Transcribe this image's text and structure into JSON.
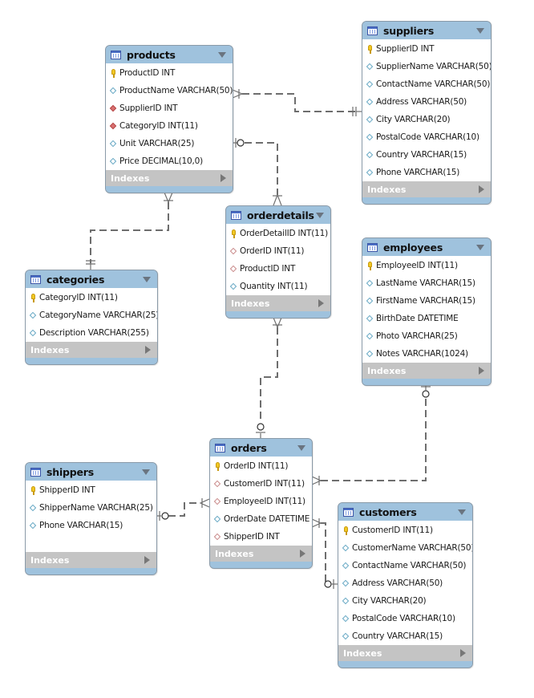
{
  "diagram": {
    "indexes_label": "Indexes",
    "tables": {
      "products": {
        "title": "products",
        "columns": [
          {
            "name": "ProductID INT",
            "kind": "pk"
          },
          {
            "name": "ProductName VARCHAR(50)",
            "kind": "plain"
          },
          {
            "name": "SupplierID INT",
            "kind": "fkfill"
          },
          {
            "name": "CategoryID INT(11)",
            "kind": "fkfill"
          },
          {
            "name": "Unit VARCHAR(25)",
            "kind": "plain"
          },
          {
            "name": "Price DECIMAL(10,0)",
            "kind": "plain"
          }
        ]
      },
      "suppliers": {
        "title": "suppliers",
        "columns": [
          {
            "name": "SupplierID INT",
            "kind": "pk"
          },
          {
            "name": "SupplierName VARCHAR(50)",
            "kind": "plain"
          },
          {
            "name": "ContactName VARCHAR(50)",
            "kind": "plain"
          },
          {
            "name": "Address VARCHAR(50)",
            "kind": "plain"
          },
          {
            "name": "City VARCHAR(20)",
            "kind": "plain"
          },
          {
            "name": "PostalCode VARCHAR(10)",
            "kind": "plain"
          },
          {
            "name": "Country VARCHAR(15)",
            "kind": "plain"
          },
          {
            "name": "Phone VARCHAR(15)",
            "kind": "plain"
          }
        ]
      },
      "orderdetails": {
        "title": "orderdetails",
        "columns": [
          {
            "name": "OrderDetailID INT(11)",
            "kind": "pk"
          },
          {
            "name": "OrderID INT(11)",
            "kind": "fk"
          },
          {
            "name": "ProductID INT",
            "kind": "fk"
          },
          {
            "name": "Quantity INT(11)",
            "kind": "plain"
          }
        ]
      },
      "categories": {
        "title": "categories",
        "columns": [
          {
            "name": "CategoryID INT(11)",
            "kind": "pk"
          },
          {
            "name": "CategoryName VARCHAR(25)",
            "kind": "plain"
          },
          {
            "name": "Description VARCHAR(255)",
            "kind": "plain"
          }
        ]
      },
      "employees": {
        "title": "employees",
        "columns": [
          {
            "name": "EmployeeID INT(11)",
            "kind": "pk"
          },
          {
            "name": "LastName VARCHAR(15)",
            "kind": "plain"
          },
          {
            "name": "FirstName VARCHAR(15)",
            "kind": "plain"
          },
          {
            "name": "BirthDate DATETIME",
            "kind": "plain"
          },
          {
            "name": "Photo VARCHAR(25)",
            "kind": "plain"
          },
          {
            "name": " Notes VARCHAR(1024)",
            "kind": "plain"
          }
        ]
      },
      "orders": {
        "title": "orders",
        "columns": [
          {
            "name": "OrderID INT(11)",
            "kind": "pk"
          },
          {
            "name": "CustomerID INT(11)",
            "kind": "fk"
          },
          {
            "name": "EmployeeID INT(11)",
            "kind": "fk"
          },
          {
            "name": "OrderDate DATETIME",
            "kind": "plain"
          },
          {
            "name": "ShipperID INT",
            "kind": "fk"
          }
        ]
      },
      "shippers": {
        "title": "shippers",
        "columns": [
          {
            "name": "ShipperID INT",
            "kind": "pk"
          },
          {
            "name": "ShipperName VARCHAR(25)",
            "kind": "plain"
          },
          {
            "name": "Phone VARCHAR(15)",
            "kind": "plain"
          }
        ]
      },
      "customers": {
        "title": "customers",
        "columns": [
          {
            "name": "CustomerID INT(11)",
            "kind": "pk"
          },
          {
            "name": "CustomerName VARCHAR(50)",
            "kind": "plain"
          },
          {
            "name": "ContactName VARCHAR(50)",
            "kind": "plain"
          },
          {
            "name": "Address VARCHAR(50)",
            "kind": "plain"
          },
          {
            "name": "City VARCHAR(20)",
            "kind": "plain"
          },
          {
            "name": "PostalCode VARCHAR(10)",
            "kind": "plain"
          },
          {
            "name": "Country VARCHAR(15)",
            "kind": "plain"
          }
        ]
      }
    },
    "relationships": [
      {
        "from": "products",
        "to": "suppliers",
        "from_end": "many-mandatory",
        "to_end": "one-mandatory"
      },
      {
        "from": "orderdetails",
        "to": "products",
        "from_end": "many-mandatory",
        "to_end": "one-optional"
      },
      {
        "from": "products",
        "to": "categories",
        "from_end": "many-mandatory",
        "to_end": "one-mandatory"
      },
      {
        "from": "orderdetails",
        "to": "orders",
        "from_end": "many-mandatory",
        "to_end": "one-optional"
      },
      {
        "from": "orders",
        "to": "employees",
        "from_end": "many-mandatory",
        "to_end": "one-optional"
      },
      {
        "from": "orders",
        "to": "shippers",
        "from_end": "many-mandatory",
        "to_end": "one-optional"
      },
      {
        "from": "orders",
        "to": "customers",
        "from_end": "many-mandatory",
        "to_end": "one-optional"
      }
    ]
  }
}
